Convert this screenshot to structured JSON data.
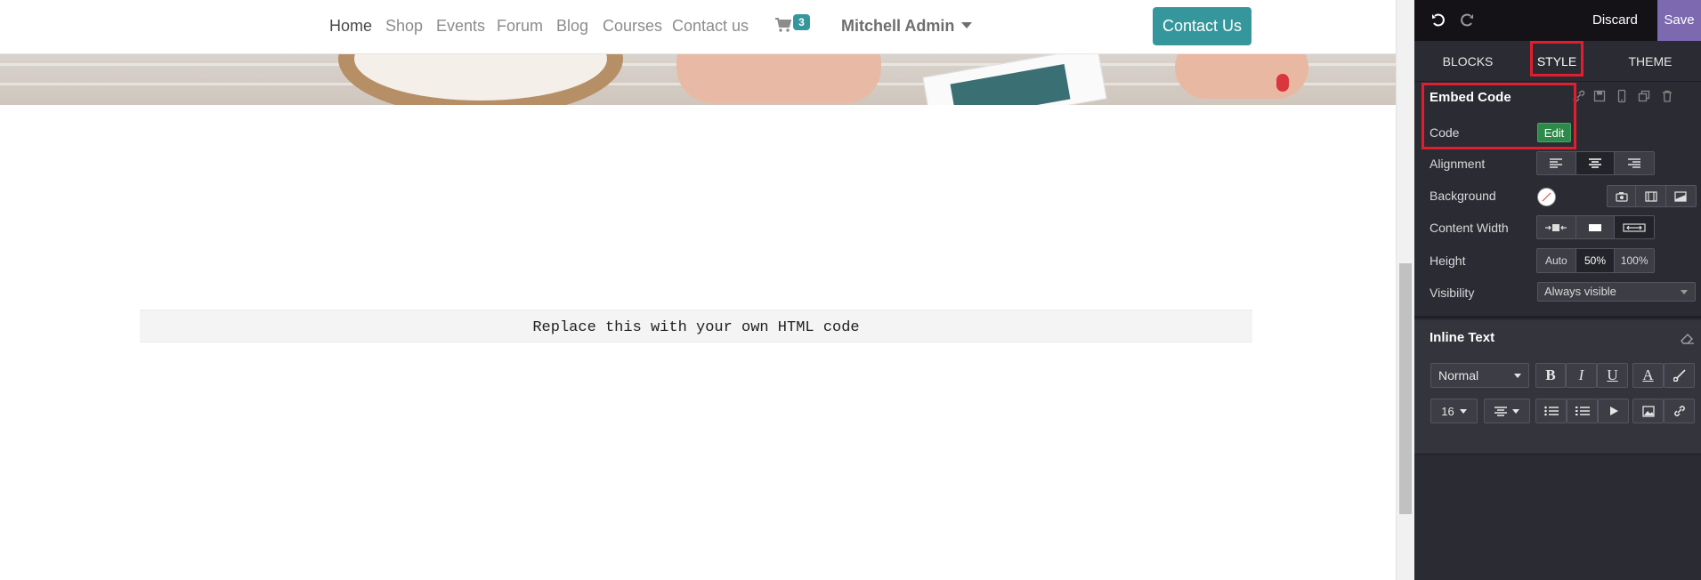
{
  "site": {
    "nav_links": [
      {
        "label": "Home",
        "active": true
      },
      {
        "label": "Shop",
        "active": false
      },
      {
        "label": "Events",
        "active": false
      },
      {
        "label": "Forum",
        "active": false
      },
      {
        "label": "Blog",
        "active": false
      },
      {
        "label": "Courses",
        "active": false
      },
      {
        "label": "Contact us",
        "active": false
      }
    ],
    "cart_count": "3",
    "user_name": "Mitchell Admin",
    "cta_label": "Contact Us",
    "embed_placeholder": "Replace this with your own HTML code"
  },
  "panel": {
    "discard_label": "Discard",
    "save_label": "Save",
    "tabs": [
      {
        "label": "BLOCKS",
        "active": false
      },
      {
        "label": "STYLE",
        "active": true
      },
      {
        "label": "THEME",
        "active": false
      }
    ],
    "embed_section": {
      "title": "Embed Code",
      "code_label": "Code",
      "edit_label": "Edit",
      "alignment_label": "Alignment",
      "background_label": "Background",
      "content_width_label": "Content Width",
      "height_label": "Height",
      "height_options": [
        "Auto",
        "50%",
        "100%"
      ],
      "height_selected": "50%",
      "visibility_label": "Visibility",
      "visibility_value": "Always visible"
    },
    "inline_text": {
      "title": "Inline Text",
      "paragraph_style": "Normal",
      "font_size": "16",
      "bold": "B",
      "italic": "I",
      "underline": "U",
      "font_color": "A"
    }
  },
  "colors": {
    "brand": "#35979c",
    "save": "#7c69b0",
    "highlight": "#e21d2d",
    "edit_button": "#2e8a4a"
  }
}
